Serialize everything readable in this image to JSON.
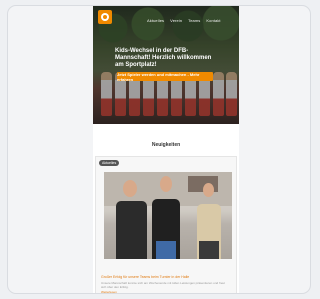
{
  "nav": {
    "items": [
      {
        "label": "Aktuelles"
      },
      {
        "label": "Verein"
      },
      {
        "label": "Teams"
      },
      {
        "label": "Kontakt"
      }
    ]
  },
  "hero": {
    "title": "Kids-Wechsel in der DFB-Mannschaft! Herzlich willkommen am Sportplatz!",
    "cta_label": "Jetzt Spieler werden und mitmachen - Mehr erfahren"
  },
  "section": {
    "title": "Neuigkeiten"
  },
  "news": {
    "tag": "Aktuelles",
    "title": "Großer Erfolg für unsere Teams beim Turnier in der Halle",
    "excerpt": "Unsere Mannschaft konnte sich am Wochenende mit tollen Leistungen präsentieren und freut sich über den Erfolg.",
    "read_more": "Weiterlesen"
  },
  "colors": {
    "accent": "#f08a00",
    "link": "#e07a10"
  },
  "icons": {
    "logo": "club-logo-icon"
  }
}
